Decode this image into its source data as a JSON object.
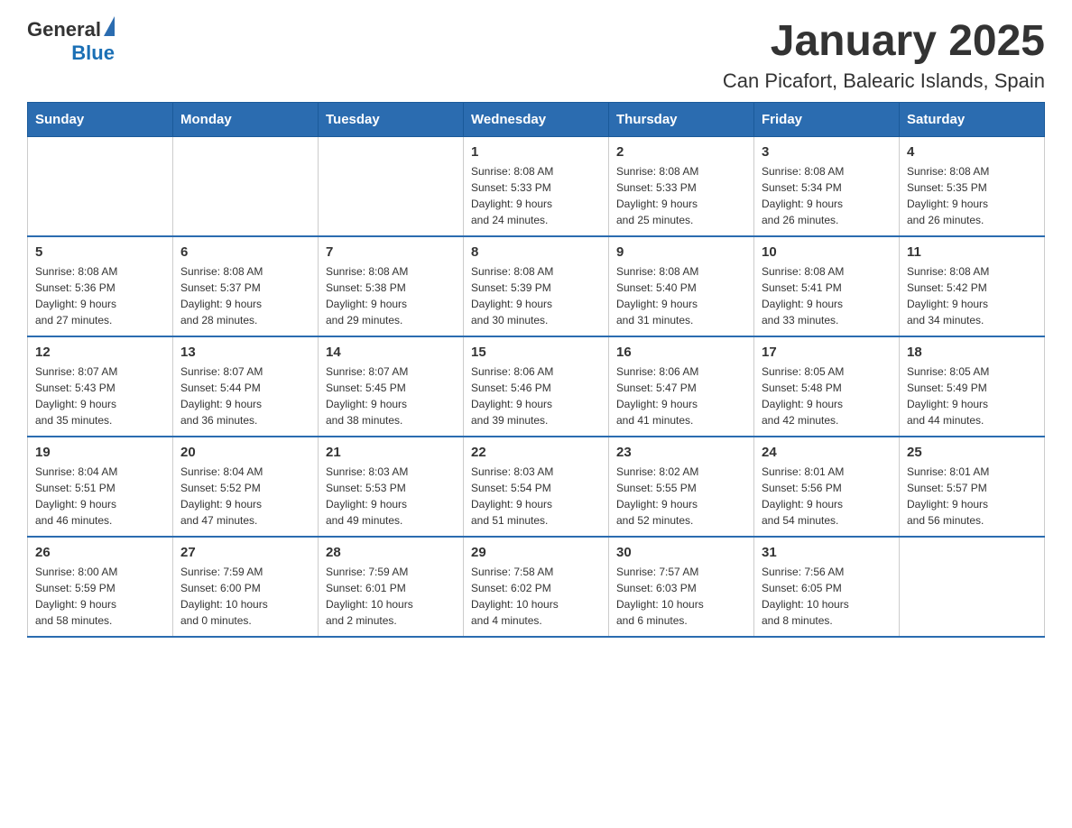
{
  "header": {
    "logo": {
      "general": "General",
      "blue": "Blue"
    },
    "title": "January 2025",
    "subtitle": "Can Picafort, Balearic Islands, Spain"
  },
  "calendar": {
    "days_of_week": [
      "Sunday",
      "Monday",
      "Tuesday",
      "Wednesday",
      "Thursday",
      "Friday",
      "Saturday"
    ],
    "weeks": [
      {
        "days": [
          {
            "num": "",
            "info": ""
          },
          {
            "num": "",
            "info": ""
          },
          {
            "num": "",
            "info": ""
          },
          {
            "num": "1",
            "info": "Sunrise: 8:08 AM\nSunset: 5:33 PM\nDaylight: 9 hours\nand 24 minutes."
          },
          {
            "num": "2",
            "info": "Sunrise: 8:08 AM\nSunset: 5:33 PM\nDaylight: 9 hours\nand 25 minutes."
          },
          {
            "num": "3",
            "info": "Sunrise: 8:08 AM\nSunset: 5:34 PM\nDaylight: 9 hours\nand 26 minutes."
          },
          {
            "num": "4",
            "info": "Sunrise: 8:08 AM\nSunset: 5:35 PM\nDaylight: 9 hours\nand 26 minutes."
          }
        ]
      },
      {
        "days": [
          {
            "num": "5",
            "info": "Sunrise: 8:08 AM\nSunset: 5:36 PM\nDaylight: 9 hours\nand 27 minutes."
          },
          {
            "num": "6",
            "info": "Sunrise: 8:08 AM\nSunset: 5:37 PM\nDaylight: 9 hours\nand 28 minutes."
          },
          {
            "num": "7",
            "info": "Sunrise: 8:08 AM\nSunset: 5:38 PM\nDaylight: 9 hours\nand 29 minutes."
          },
          {
            "num": "8",
            "info": "Sunrise: 8:08 AM\nSunset: 5:39 PM\nDaylight: 9 hours\nand 30 minutes."
          },
          {
            "num": "9",
            "info": "Sunrise: 8:08 AM\nSunset: 5:40 PM\nDaylight: 9 hours\nand 31 minutes."
          },
          {
            "num": "10",
            "info": "Sunrise: 8:08 AM\nSunset: 5:41 PM\nDaylight: 9 hours\nand 33 minutes."
          },
          {
            "num": "11",
            "info": "Sunrise: 8:08 AM\nSunset: 5:42 PM\nDaylight: 9 hours\nand 34 minutes."
          }
        ]
      },
      {
        "days": [
          {
            "num": "12",
            "info": "Sunrise: 8:07 AM\nSunset: 5:43 PM\nDaylight: 9 hours\nand 35 minutes."
          },
          {
            "num": "13",
            "info": "Sunrise: 8:07 AM\nSunset: 5:44 PM\nDaylight: 9 hours\nand 36 minutes."
          },
          {
            "num": "14",
            "info": "Sunrise: 8:07 AM\nSunset: 5:45 PM\nDaylight: 9 hours\nand 38 minutes."
          },
          {
            "num": "15",
            "info": "Sunrise: 8:06 AM\nSunset: 5:46 PM\nDaylight: 9 hours\nand 39 minutes."
          },
          {
            "num": "16",
            "info": "Sunrise: 8:06 AM\nSunset: 5:47 PM\nDaylight: 9 hours\nand 41 minutes."
          },
          {
            "num": "17",
            "info": "Sunrise: 8:05 AM\nSunset: 5:48 PM\nDaylight: 9 hours\nand 42 minutes."
          },
          {
            "num": "18",
            "info": "Sunrise: 8:05 AM\nSunset: 5:49 PM\nDaylight: 9 hours\nand 44 minutes."
          }
        ]
      },
      {
        "days": [
          {
            "num": "19",
            "info": "Sunrise: 8:04 AM\nSunset: 5:51 PM\nDaylight: 9 hours\nand 46 minutes."
          },
          {
            "num": "20",
            "info": "Sunrise: 8:04 AM\nSunset: 5:52 PM\nDaylight: 9 hours\nand 47 minutes."
          },
          {
            "num": "21",
            "info": "Sunrise: 8:03 AM\nSunset: 5:53 PM\nDaylight: 9 hours\nand 49 minutes."
          },
          {
            "num": "22",
            "info": "Sunrise: 8:03 AM\nSunset: 5:54 PM\nDaylight: 9 hours\nand 51 minutes."
          },
          {
            "num": "23",
            "info": "Sunrise: 8:02 AM\nSunset: 5:55 PM\nDaylight: 9 hours\nand 52 minutes."
          },
          {
            "num": "24",
            "info": "Sunrise: 8:01 AM\nSunset: 5:56 PM\nDaylight: 9 hours\nand 54 minutes."
          },
          {
            "num": "25",
            "info": "Sunrise: 8:01 AM\nSunset: 5:57 PM\nDaylight: 9 hours\nand 56 minutes."
          }
        ]
      },
      {
        "days": [
          {
            "num": "26",
            "info": "Sunrise: 8:00 AM\nSunset: 5:59 PM\nDaylight: 9 hours\nand 58 minutes."
          },
          {
            "num": "27",
            "info": "Sunrise: 7:59 AM\nSunset: 6:00 PM\nDaylight: 10 hours\nand 0 minutes."
          },
          {
            "num": "28",
            "info": "Sunrise: 7:59 AM\nSunset: 6:01 PM\nDaylight: 10 hours\nand 2 minutes."
          },
          {
            "num": "29",
            "info": "Sunrise: 7:58 AM\nSunset: 6:02 PM\nDaylight: 10 hours\nand 4 minutes."
          },
          {
            "num": "30",
            "info": "Sunrise: 7:57 AM\nSunset: 6:03 PM\nDaylight: 10 hours\nand 6 minutes."
          },
          {
            "num": "31",
            "info": "Sunrise: 7:56 AM\nSunset: 6:05 PM\nDaylight: 10 hours\nand 8 minutes."
          },
          {
            "num": "",
            "info": ""
          }
        ]
      }
    ]
  }
}
